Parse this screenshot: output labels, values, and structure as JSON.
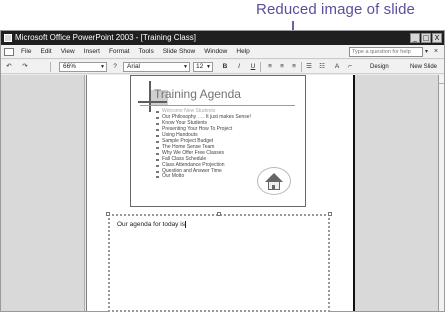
{
  "callout": {
    "text": "Reduced image of slide"
  },
  "window": {
    "title": "Microsoft Office PowerPoint 2003 - [Training Class]",
    "buttons": {
      "minimize": "_",
      "restore": "□",
      "close": "X"
    }
  },
  "menubar": {
    "items": [
      "File",
      "Edit",
      "View",
      "Insert",
      "Format",
      "Tools",
      "Slide Show",
      "Window",
      "Help"
    ],
    "help_placeholder": "Type a question for help",
    "help_arrow": "▾",
    "close_doc": "×"
  },
  "toolbar": {
    "zoom": "66%",
    "font": "Arial",
    "font_size": "12",
    "bold": "B",
    "italic": "I",
    "underline": "U",
    "design": "Design",
    "new_slide": "New Slide"
  },
  "slide": {
    "title": "Training Agenda",
    "bullets": [
      "Welcome New Students",
      "Our Philosophy . . . It just makes Sense!",
      "Know Your Students",
      "Presenting Your How To Project",
      "Using Handouts",
      "Sample Project Budget",
      "The Home Sense Team",
      "Why We Offer Free Classes",
      "Fall Class Schedule",
      "Class Attendance Projection",
      "Question and Answer Time",
      "Our Motto"
    ]
  },
  "notes": {
    "text": "Our agenda for today is:"
  },
  "icons": {
    "house": "house-icon",
    "app": "powerpoint-icon"
  }
}
